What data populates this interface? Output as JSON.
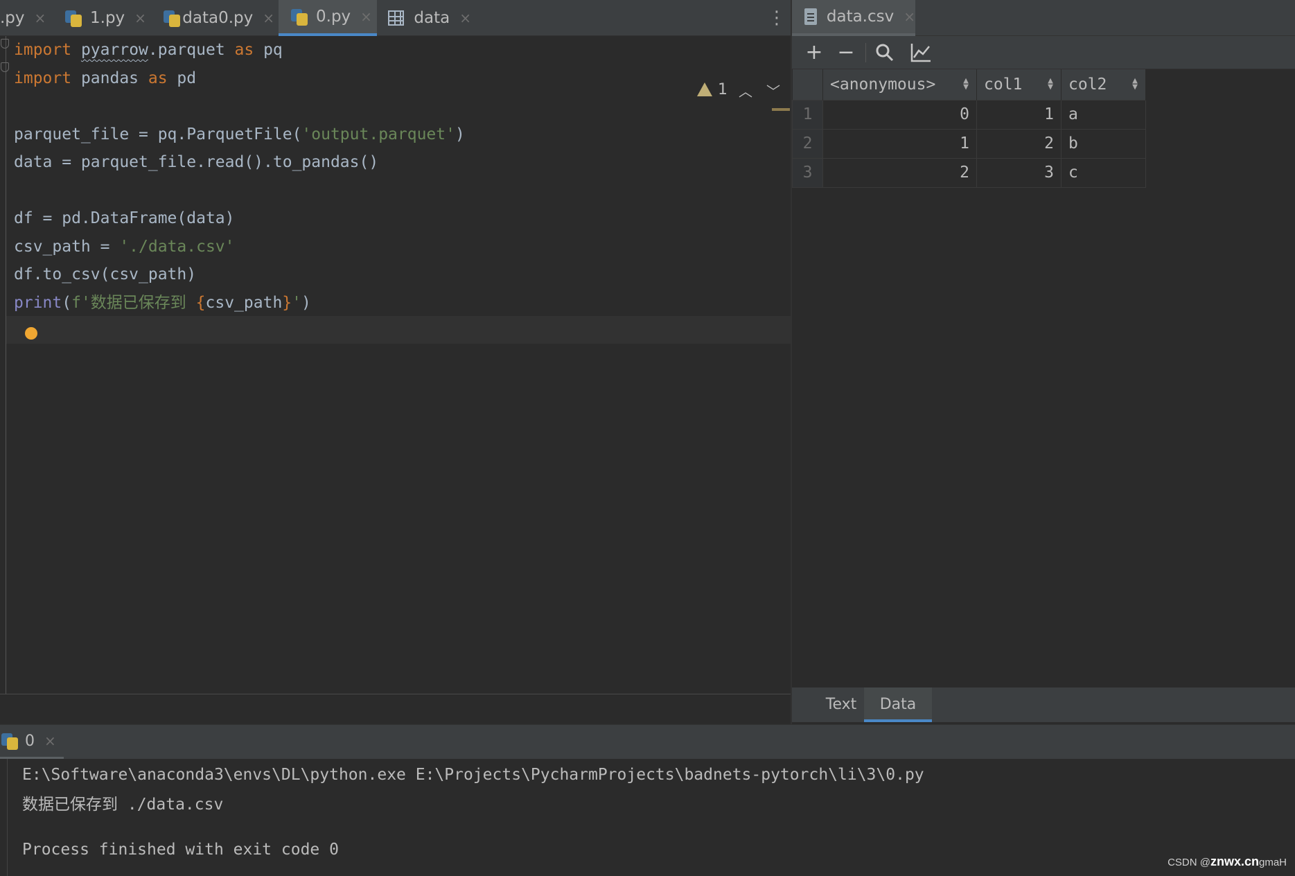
{
  "editor_tabs": [
    {
      "label": ".py",
      "close": "×"
    },
    {
      "label": "1.py",
      "close": "×"
    },
    {
      "label": "data0.py",
      "close": "×"
    },
    {
      "label": "0.py",
      "close": "×"
    },
    {
      "label": "data",
      "close": "×"
    }
  ],
  "editor": {
    "inspection_count": "1",
    "code_lines": [
      "import pyarrow.parquet as pq",
      "import pandas as pd",
      "",
      "parquet_file = pq.ParquetFile('output.parquet')",
      "data = parquet_file.read().to_pandas()",
      "",
      "df = pd.DataFrame(data)",
      "csv_path = './data.csv'",
      "df.to_csv(csv_path)",
      "print(f'数据已保存到 {csv_path}')"
    ]
  },
  "right_panel": {
    "tab_label": "data.csv",
    "tab_close": "×",
    "columns": [
      "<anonymous>",
      "col1",
      "col2"
    ],
    "rows": [
      {
        "num": "1",
        "cells": [
          "0",
          "1",
          "a"
        ]
      },
      {
        "num": "2",
        "cells": [
          "1",
          "2",
          "b"
        ]
      },
      {
        "num": "3",
        "cells": [
          "2",
          "3",
          "c"
        ]
      }
    ],
    "bottom_tabs": [
      "Text",
      "Data"
    ],
    "active_bottom_tab": "Data"
  },
  "run": {
    "tab_label": "0",
    "tab_close": "×",
    "lines": [
      "E:\\Software\\anaconda3\\envs\\DL\\python.exe E:\\Projects\\PycharmProjects\\badnets-pytorch\\li\\3\\0.py",
      "数据已保存到 ./data.csv",
      "",
      "Process finished with exit code 0"
    ]
  },
  "watermark": {
    "prefix": "CSDN @",
    "site": "znwx.cn",
    "suffix": "gmaH"
  },
  "colors": {
    "accent": "#4a88c7",
    "keyword": "#cc7832",
    "string": "#6a8759",
    "builtin": "#8888c6"
  }
}
